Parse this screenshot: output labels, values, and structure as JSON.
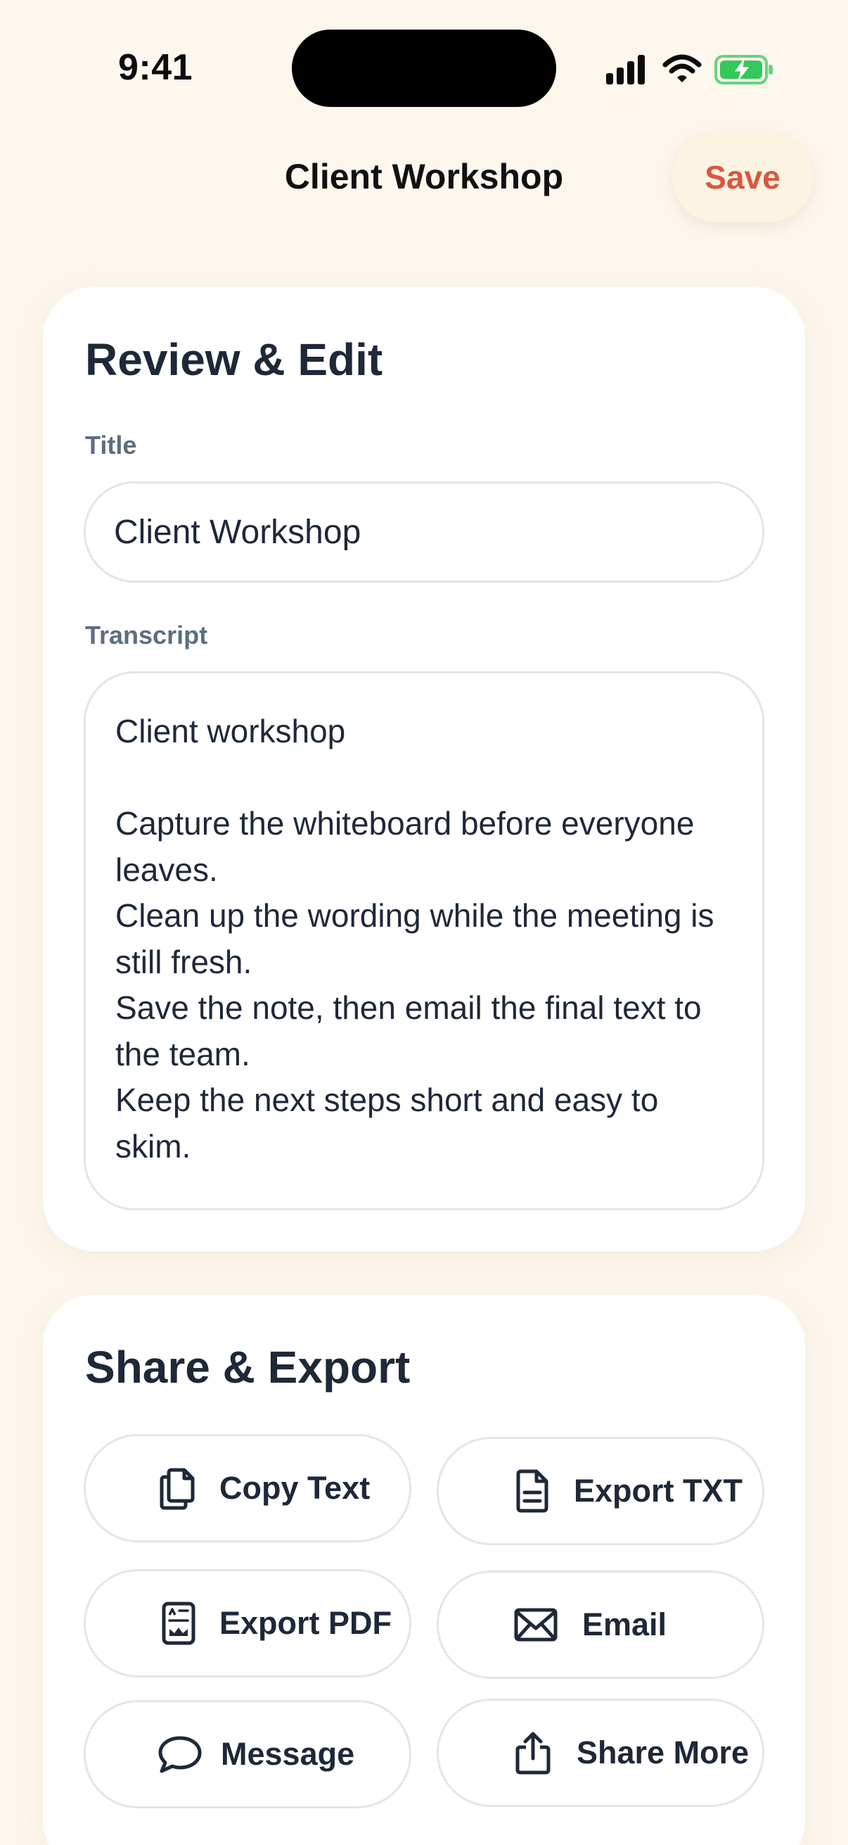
{
  "status_bar": {
    "time": "9:41"
  },
  "nav": {
    "title": "Client Workshop",
    "save_label": "Save"
  },
  "edit_card": {
    "heading": "Review & Edit",
    "title_label": "Title",
    "title_value": "Client Workshop",
    "transcript_label": "Transcript",
    "transcript_value": "Client workshop\n\nCapture the whiteboard before everyone leaves.\nClean up the wording while the meeting is still fresh.\nSave the note, then email the final text to the team.\nKeep the next steps short and easy to skim."
  },
  "share_card": {
    "heading": "Share & Export",
    "actions": [
      {
        "label": "Copy Text",
        "icon": "copy-icon"
      },
      {
        "label": "Export TXT",
        "icon": "document-icon"
      },
      {
        "label": "Export PDF",
        "icon": "pdf-icon"
      },
      {
        "label": "Email",
        "icon": "envelope-icon"
      },
      {
        "label": "Message",
        "icon": "message-bubble-icon"
      },
      {
        "label": "Share More",
        "icon": "share-icon"
      }
    ]
  },
  "colors": {
    "background": "#FDF7EE",
    "card": "#FFFFFF",
    "accent": "#D9573F",
    "text": "#1E2838",
    "label": "#5E6D80",
    "battery": "#34C759"
  }
}
